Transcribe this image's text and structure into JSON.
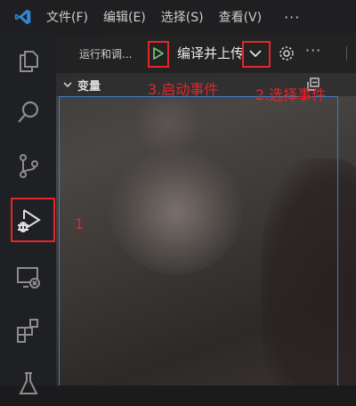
{
  "menu": {
    "items": [
      "文件(F)",
      "编辑(E)",
      "选择(S)",
      "查看(V)"
    ],
    "more": "···"
  },
  "activity_bar": {
    "icons": [
      "files-icon",
      "search-icon",
      "source-control-icon",
      "run-debug-icon",
      "remote-explorer-icon",
      "extensions-icon",
      "testing-icon"
    ]
  },
  "debug": {
    "title": "运行和调...",
    "config_name": "编译并上传",
    "more": "···"
  },
  "variables": {
    "title": "变量"
  },
  "annotations": {
    "step1": "1",
    "step2": "2.选择事件",
    "step3": "3.启动事件"
  },
  "colors": {
    "accent_blue": "#3b7fc4",
    "annotation_red": "#e3262b",
    "play_green": "#6fc36f"
  }
}
